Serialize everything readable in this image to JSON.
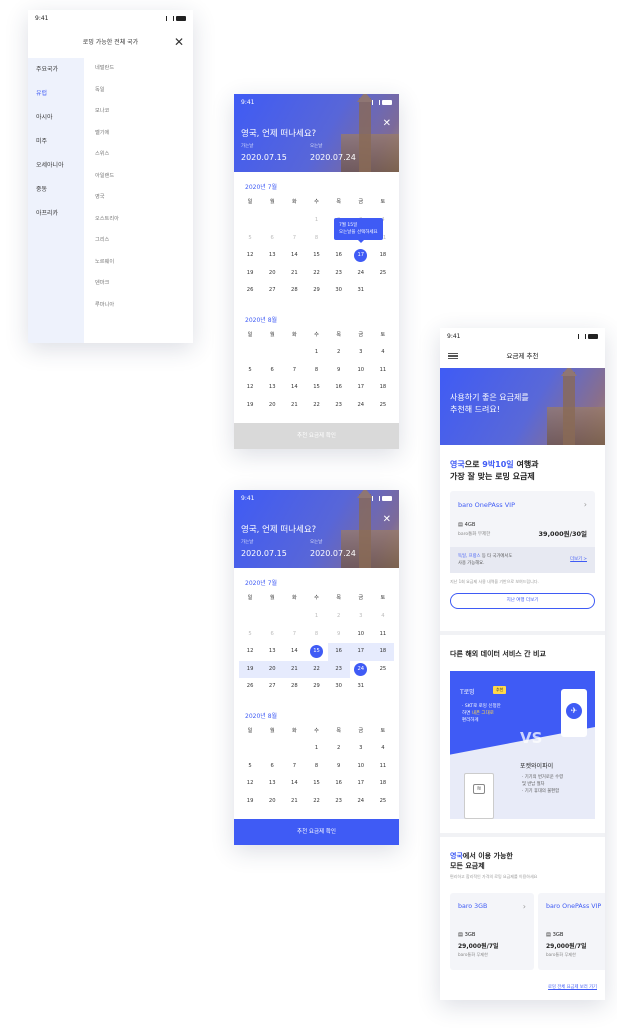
{
  "status_time": "9:41",
  "country_screen": {
    "title": "로밍 가능한 전체 국가",
    "regions": [
      "주요국가",
      "유럽",
      "아시아",
      "미주",
      "오세아니아",
      "중동",
      "아프리카"
    ],
    "countries": [
      "네덜란드",
      "독일",
      "모나코",
      "벨기에",
      "스위스",
      "아일랜드",
      "영국",
      "오스트리아",
      "그리스",
      "노르웨이",
      "덴마크",
      "루마니아"
    ]
  },
  "calendar": {
    "question": "영국, 언제 떠나세요?",
    "start_label": "가는날",
    "start_date": "2020.07.15",
    "end_label": "오는날",
    "end_date": "2020.07.24",
    "july_title": "2020년 7월",
    "aug_title": "2020년 8월",
    "weekdays": [
      "일",
      "월",
      "화",
      "수",
      "목",
      "금",
      "토"
    ],
    "tooltip_line1": "7월 15일",
    "tooltip_line2": "오는날을 선택하세요",
    "confirm_label": "추천 요금제 확인"
  },
  "plan_screen": {
    "nav_title": "요금제 추천",
    "banner_line1": "사용하기 좋은 요금제를",
    "banner_line2": "추천해 드려요!",
    "headline_country": "영국",
    "headline_mid": "으로 ",
    "headline_duration": "9박10일",
    "headline_tail": " 여행과",
    "headline_line2": "가장 잘 맞는 로밍 요금제",
    "plan_name": "baro OnePAss VIP",
    "plan_data": "4GB",
    "plan_free": "baro통화 무제한",
    "plan_price": "39,000원/30일",
    "note_countries": "독일, 프랑스",
    "note_rest": " 등 타 국가에서도",
    "note_line2": "사용 가능해요.",
    "note_more": "더보기 >",
    "history_hint": "지난 1회 요금제 사용 내역을 기반으로 보여드립니다.",
    "history_button": "지난 여행 더보기",
    "compare_title": "다른 해외 데이터 서비스 간 비교",
    "troaming_label": "T로밍",
    "troaming_badge": "추천",
    "troaming_desc1": "· SKT로 로밍 신청만",
    "troaming_desc2_pre": "하면 ",
    "troaming_desc2_hl": "내폰 그대로",
    "troaming_desc3": "편리하게",
    "vs_label": "VS",
    "wifi_label": "포켓와이파이",
    "wifi_desc1": "· 기기의 번거로운 수령",
    "wifi_desc2": "및 반납 절차",
    "wifi_desc3": "· 기기 휴대의 불편함",
    "all_country": "영국",
    "all_title_rest": "에서 이용 가능한",
    "all_title_line2": "모든 요금제",
    "all_sub": "편리하고 합리적인 가격의 로밍 요금제를 이용하세요",
    "cards": [
      {
        "name": "baro 3GB",
        "data": "3GB",
        "price": "29,000원/7일",
        "free": "baro통화 무제한"
      },
      {
        "name": "baro OnePAss VIP",
        "data": "3GB",
        "price": "29,000원/7일",
        "free": "baro통화 무제한"
      }
    ],
    "all_link": "로밍 전체 요금제 보러 가기"
  }
}
